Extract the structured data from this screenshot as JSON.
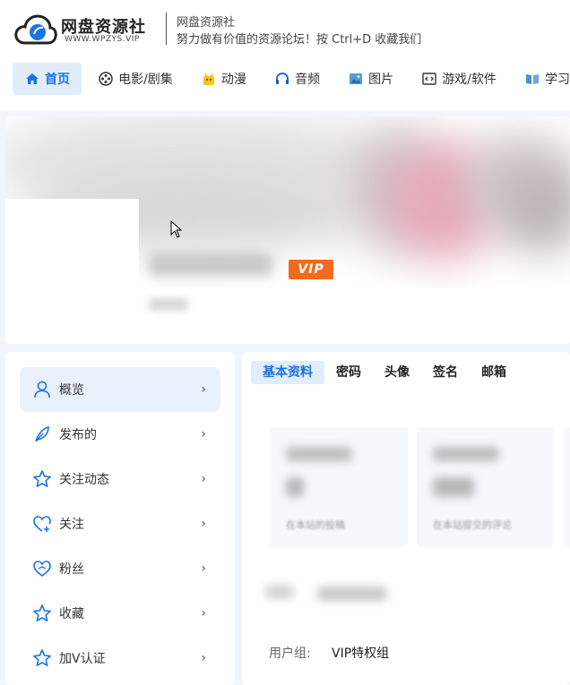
{
  "header": {
    "logo_name": "网盘资源社",
    "logo_domain": "WWW.WPZYS.VIP",
    "tagline_title": "网盘资源社",
    "tagline_sub": "努力做有价值的资源论坛！按 Ctrl+D 收藏我们"
  },
  "nav": {
    "items": [
      {
        "label": "首页",
        "icon": "home-icon",
        "active": true
      },
      {
        "label": "电影/剧集",
        "icon": "film-reel-icon"
      },
      {
        "label": "动漫",
        "icon": "anime-icon"
      },
      {
        "label": "音频",
        "icon": "headphones-icon"
      },
      {
        "label": "图片",
        "icon": "image-icon"
      },
      {
        "label": "游戏/软件",
        "icon": "code-window-icon"
      },
      {
        "label": "学习",
        "icon": "book-icon"
      }
    ]
  },
  "profile": {
    "vip_label": "VIP"
  },
  "sidebar": {
    "items": [
      {
        "label": "概览",
        "icon": "user-icon",
        "active": true
      },
      {
        "label": "发布的",
        "icon": "feather-icon"
      },
      {
        "label": "关注动态",
        "icon": "star-icon"
      },
      {
        "label": "关注",
        "icon": "heart-plus-icon"
      },
      {
        "label": "粉丝",
        "icon": "heart-link-icon"
      },
      {
        "label": "收藏",
        "icon": "star-icon"
      },
      {
        "label": "加V认证",
        "icon": "star-icon"
      }
    ],
    "chevron": "›"
  },
  "main": {
    "tabs": [
      {
        "label": "基本资料",
        "active": true
      },
      {
        "label": "密码"
      },
      {
        "label": "头像"
      },
      {
        "label": "签名"
      },
      {
        "label": "邮箱"
      }
    ],
    "stats": [
      {
        "desc": "在本站的投稿"
      },
      {
        "desc": "在本站提交的评论"
      }
    ],
    "group_label": "用户组:",
    "group_value": "VIP特权组"
  },
  "colors": {
    "accent": "#1a73e8",
    "active_bg": "#e1edfb",
    "vip": "#f26a1b",
    "page_bg": "#f2f5f9"
  }
}
